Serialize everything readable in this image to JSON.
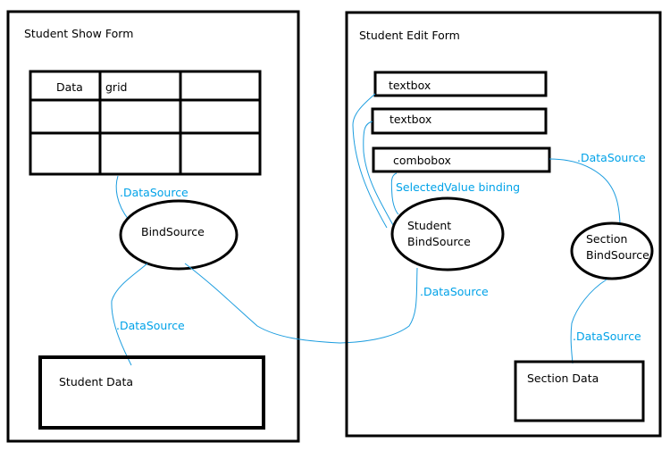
{
  "colors": {
    "outline": "#000000",
    "connector": "#00a2e8"
  },
  "show_form": {
    "title": "Student Show Form",
    "grid": {
      "header": [
        "Data",
        "grid",
        ""
      ]
    },
    "grid_link_label": ".DataSource",
    "bind_source": "BindSource",
    "data_link_label": ".DataSource",
    "data_box": "Student Data"
  },
  "edit_form": {
    "title": "Student Edit Form",
    "textbox1": "textbox",
    "textbox2": "textbox",
    "combobox": "combobox",
    "selected_value_label": "SelectedValue binding",
    "combo_link_label": ".DataSource",
    "student_bind_source": [
      "Student",
      "BindSource"
    ],
    "student_link_label": ".DataSource",
    "section_bind_source": [
      "Section",
      "BindSource"
    ],
    "section_link_label": ".DataSource",
    "section_data": "Section Data"
  }
}
